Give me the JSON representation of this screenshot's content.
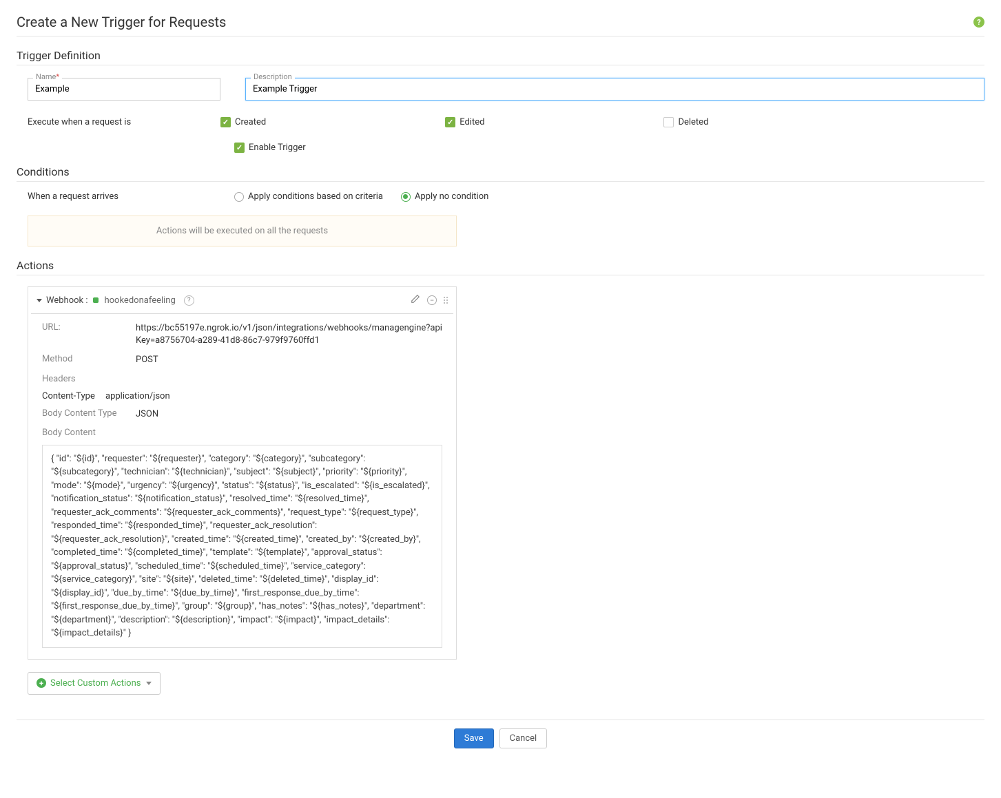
{
  "page": {
    "title": "Create a New Trigger for Requests"
  },
  "definition": {
    "section_title": "Trigger Definition",
    "name_label": "Name",
    "name_value": "Example",
    "description_label": "Description",
    "description_value": "Example Trigger",
    "execute_label": "Execute when a request is",
    "checks": {
      "created": {
        "label": "Created",
        "checked": true
      },
      "edited": {
        "label": "Edited",
        "checked": true
      },
      "deleted": {
        "label": "Deleted",
        "checked": false
      }
    },
    "enable_trigger": {
      "label": "Enable Trigger",
      "checked": true
    }
  },
  "conditions": {
    "section_title": "Conditions",
    "arrive_label": "When a request arrives",
    "radios": {
      "criteria": {
        "label": "Apply conditions based on criteria",
        "selected": false
      },
      "none": {
        "label": "Apply no condition",
        "selected": true
      }
    },
    "notice": "Actions will be executed on all the requests"
  },
  "actions": {
    "section_title": "Actions",
    "webhook": {
      "prefix": "Webhook :",
      "name": "hookedonafeeling",
      "url_label": "URL:",
      "url_value": "https://bc55197e.ngrok.io/v1/json/integrations/webhooks/managengine?apiKey=a8756704-a289-41d8-86c7-979f9760ffd1",
      "method_label": "Method",
      "method_value": "POST",
      "headers_label": "Headers",
      "header_key": "Content-Type",
      "header_val": "application/json",
      "body_type_label": "Body Content Type",
      "body_type_value": "JSON",
      "body_content_label": "Body Content",
      "body_content_value": "{ \"id\": \"${id}\", \"requester\": \"${requester}\", \"category\": \"${category}\", \"subcategory\": \"${subcategory}\", \"technician\": \"${technician}\", \"subject\": \"${subject}\", \"priority\": \"${priority}\", \"mode\": \"${mode}\", \"urgency\": \"${urgency}\", \"status\": \"${status}\", \"is_escalated\": \"${is_escalated}\", \"notification_status\": \"${notification_status}\", \"resolved_time\": \"${resolved_time}\", \"requester_ack_comments\": \"${requester_ack_comments}\", \"request_type\": \"${request_type}\", \"responded_time\": \"${responded_time}\", \"requester_ack_resolution\": \"${requester_ack_resolution}\", \"created_time\": \"${created_time}\", \"created_by\": \"${created_by}\", \"completed_time\": \"${completed_time}\", \"template\": \"${template}\", \"approval_status\": \"${approval_status}\", \"scheduled_time\": \"${scheduled_time}\", \"service_category\": \"${service_category}\", \"site\": \"${site}\", \"deleted_time\": \"${deleted_time}\", \"display_id\": \"${display_id}\", \"due_by_time\": \"${due_by_time}\", \"first_response_due_by_time\": \"${first_response_due_by_time}\", \"group\": \"${group}\", \"has_notes\": \"${has_notes}\", \"department\": \"${department}\", \"description\": \"${description}\", \"impact\": \"${impact}\", \"impact_details\": \"${impact_details}\" }"
    },
    "select_actions_label": "Select Custom Actions"
  },
  "footer": {
    "save": "Save",
    "cancel": "Cancel"
  }
}
